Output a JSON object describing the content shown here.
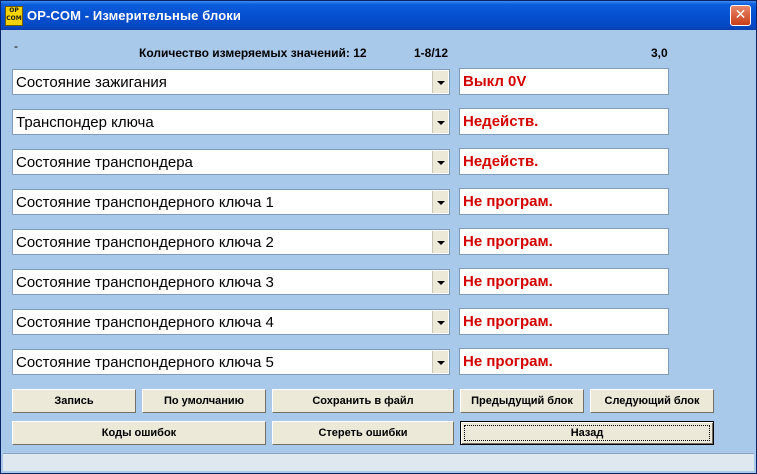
{
  "window": {
    "title": "OP-COM - Измерительные блоки",
    "icon_text": [
      "OP",
      "COM"
    ],
    "close_icon": "close-icon"
  },
  "header": {
    "dash": "-",
    "count_label": "Количество измеряемых значений: 12",
    "block_range": "1-8/12",
    "version": "3,0"
  },
  "rows": [
    {
      "label": "Состояние зажигания",
      "value": "Выкл  0V"
    },
    {
      "label": "Транспондер ключа",
      "value": "Недейств."
    },
    {
      "label": "Состояние транспондера",
      "value": "Недейств."
    },
    {
      "label": "Состояние транспондерного ключа 1",
      "value": "Не програм."
    },
    {
      "label": "Состояние транспондерного ключа 2",
      "value": "Не програм."
    },
    {
      "label": "Состояние транспондерного ключа 3",
      "value": "Не програм."
    },
    {
      "label": "Состояние транспондерного ключа 4",
      "value": "Не програм."
    },
    {
      "label": "Состояние транспондерного ключа 5",
      "value": "Не програм."
    }
  ],
  "buttons": {
    "record": "Запись",
    "defaults": "По умолчанию",
    "save_file": "Сохранить в файл",
    "prev_block": "Предыдущий блок",
    "next_block": "Следующий блок",
    "error_codes": "Коды ошибок",
    "clear_errors": "Стереть ошибки",
    "back": "Назад"
  },
  "colors": {
    "value_text": "#d40000",
    "window_bg": "#a9c9ea",
    "titlebar": "#0650d0"
  }
}
